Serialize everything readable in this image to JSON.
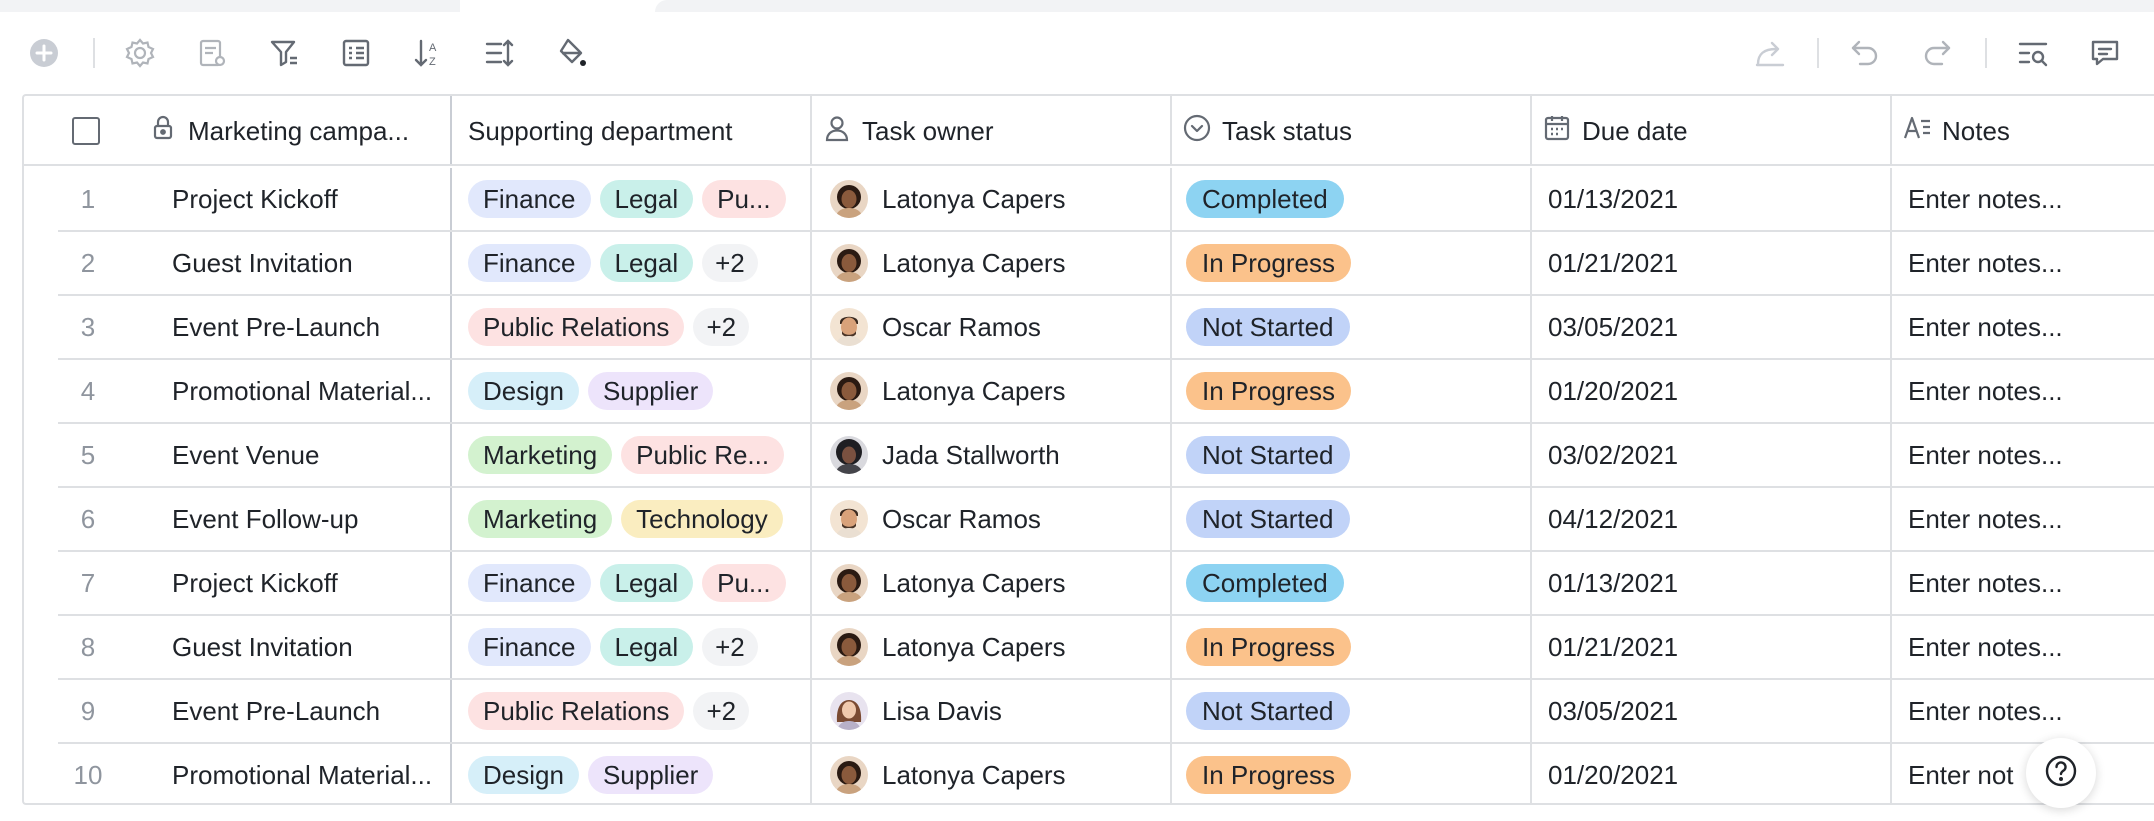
{
  "toolbar": {
    "left_icons": [
      "add-record-icon",
      "settings-icon",
      "form-settings-icon",
      "filter-icon",
      "checklist-icon",
      "sort-icon",
      "row-height-icon",
      "fill-color-icon"
    ],
    "right_icons": [
      "share-icon",
      "undo-icon",
      "redo-icon",
      "search-icon",
      "comment-icon"
    ]
  },
  "columns": [
    {
      "label": "Marketing campa...",
      "icon": "lock-icon"
    },
    {
      "label": "Supporting department",
      "icon": ""
    },
    {
      "label": "Task owner",
      "icon": "person-icon"
    },
    {
      "label": "Task status",
      "icon": "status-circle-icon"
    },
    {
      "label": "Due date",
      "icon": "calendar-icon"
    },
    {
      "label": "Notes",
      "icon": "text-icon"
    }
  ],
  "tag_colors": {
    "Finance": "#e1e8fc",
    "Legal": "#c9f0ea",
    "Pu...": "#fde2e2",
    "Public Relations": "#fde2e2",
    "Public Re...": "#fde2e2",
    "Design": "#d6eff9",
    "Supplier": "#ede4fb",
    "Marketing": "#d3f2cf",
    "Technology": "#faedc0"
  },
  "status_colors": {
    "Completed": "#8dd3f2",
    "In Progress": "#fbc28b",
    "Not Started": "#c1d3f8"
  },
  "rows": [
    {
      "num": "1",
      "campaign": "Project Kickoff",
      "departments": [
        "Finance",
        "Legal",
        "Pu..."
      ],
      "owner": "Latonya Capers",
      "avatar": "latonya",
      "status": "Completed",
      "due": "01/13/2021",
      "notes": "Enter notes..."
    },
    {
      "num": "2",
      "campaign": "Guest Invitation",
      "departments": [
        "Finance",
        "Legal",
        "+2"
      ],
      "owner": "Latonya Capers",
      "avatar": "latonya",
      "status": "In Progress",
      "due": "01/21/2021",
      "notes": "Enter notes..."
    },
    {
      "num": "3",
      "campaign": "Event Pre-Launch",
      "departments": [
        "Public Relations",
        "+2"
      ],
      "owner": "Oscar Ramos",
      "avatar": "oscar",
      "status": "Not Started",
      "due": "03/05/2021",
      "notes": "Enter notes..."
    },
    {
      "num": "4",
      "campaign": "Promotional Material...",
      "departments": [
        "Design",
        "Supplier"
      ],
      "owner": "Latonya Capers",
      "avatar": "latonya",
      "status": "In Progress",
      "due": "01/20/2021",
      "notes": "Enter notes..."
    },
    {
      "num": "5",
      "campaign": "Event Venue",
      "departments": [
        "Marketing",
        "Public Re..."
      ],
      "owner": "Jada Stallworth",
      "avatar": "jada",
      "status": "Not Started",
      "due": "03/02/2021",
      "notes": "Enter notes..."
    },
    {
      "num": "6",
      "campaign": "Event Follow-up",
      "departments": [
        "Marketing",
        "Technology"
      ],
      "owner": "Oscar Ramos",
      "avatar": "oscar",
      "status": "Not Started",
      "due": "04/12/2021",
      "notes": "Enter notes..."
    },
    {
      "num": "7",
      "campaign": "Project Kickoff",
      "departments": [
        "Finance",
        "Legal",
        "Pu..."
      ],
      "owner": "Latonya Capers",
      "avatar": "latonya",
      "status": "Completed",
      "due": "01/13/2021",
      "notes": "Enter notes..."
    },
    {
      "num": "8",
      "campaign": "Guest Invitation",
      "departments": [
        "Finance",
        "Legal",
        "+2"
      ],
      "owner": "Latonya Capers",
      "avatar": "latonya",
      "status": "In Progress",
      "due": "01/21/2021",
      "notes": "Enter notes..."
    },
    {
      "num": "9",
      "campaign": "Event Pre-Launch",
      "departments": [
        "Public Relations",
        "+2"
      ],
      "owner": "Lisa Davis",
      "avatar": "lisa",
      "status": "Not Started",
      "due": "03/05/2021",
      "notes": "Enter notes..."
    },
    {
      "num": "10",
      "campaign": "Promotional Material...",
      "departments": [
        "Design",
        "Supplier"
      ],
      "owner": "Latonya Capers",
      "avatar": "latonya",
      "status": "In Progress",
      "due": "01/20/2021",
      "notes": "Enter not"
    }
  ],
  "help_icon": "help-icon"
}
